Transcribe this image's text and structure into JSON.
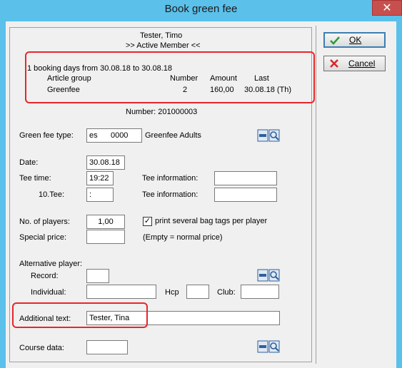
{
  "window": {
    "title": "Book green fee",
    "close_glyph": "✕"
  },
  "header": {
    "member_name": "Tester, Timo",
    "member_status": ">> Active Member <<"
  },
  "booking": {
    "summary": "1 booking days from 30.08.18 to 30.08.18",
    "columns": [
      "Article group",
      "Number",
      "Amount",
      "Last"
    ],
    "rows": [
      {
        "group": "Greenfee",
        "number": "2",
        "amount": "160,00",
        "last": "30.08.18 (Th)"
      }
    ]
  },
  "number_line": "Number: 201000003",
  "form": {
    "green_fee_type_label": "Green fee type:",
    "green_fee_code": "es      0000",
    "green_fee_desc": "Greenfee Adults",
    "date_label": "Date:",
    "date_value": "30.08.18",
    "tee_time_label": "Tee time:",
    "tee_time_value": "19:22",
    "tee_info_label_1": "Tee information:",
    "tee_info_value_1": "",
    "tee10_label": "10.Tee:",
    "tee10_value": ":",
    "tee_info_label_2": "Tee information:",
    "tee_info_value_2": "",
    "players_label": "No. of players:",
    "players_value": "1,00",
    "print_bag_tags_label": "print several bag tags per player",
    "print_bag_tags_checked": true,
    "special_price_label": "Special price:",
    "special_price_value": "",
    "special_price_hint": "(Empty = normal price)",
    "alt_player_label": "Alternative player:",
    "record_label": "Record:",
    "record_value": "",
    "individual_label": "Individual:",
    "individual_value": "",
    "hcp_label": "Hcp",
    "hcp_value": "",
    "club_label": "Club:",
    "club_value": "",
    "additional_text_label": "Additional text:",
    "additional_text_value": "Tester, Tina",
    "course_data_label": "Course data:",
    "course_data_value": ""
  },
  "buttons": {
    "ok_label": "OK",
    "cancel_label": "Cancel"
  },
  "colors": {
    "titlebar": "#5bc0ea",
    "close": "#c7504f",
    "highlight": "#e8262a",
    "ok_check": "#2e9b3a",
    "cancel_x": "#d9262a"
  },
  "icons": [
    "close-icon",
    "check-icon",
    "x-icon",
    "lookup-icon"
  ]
}
